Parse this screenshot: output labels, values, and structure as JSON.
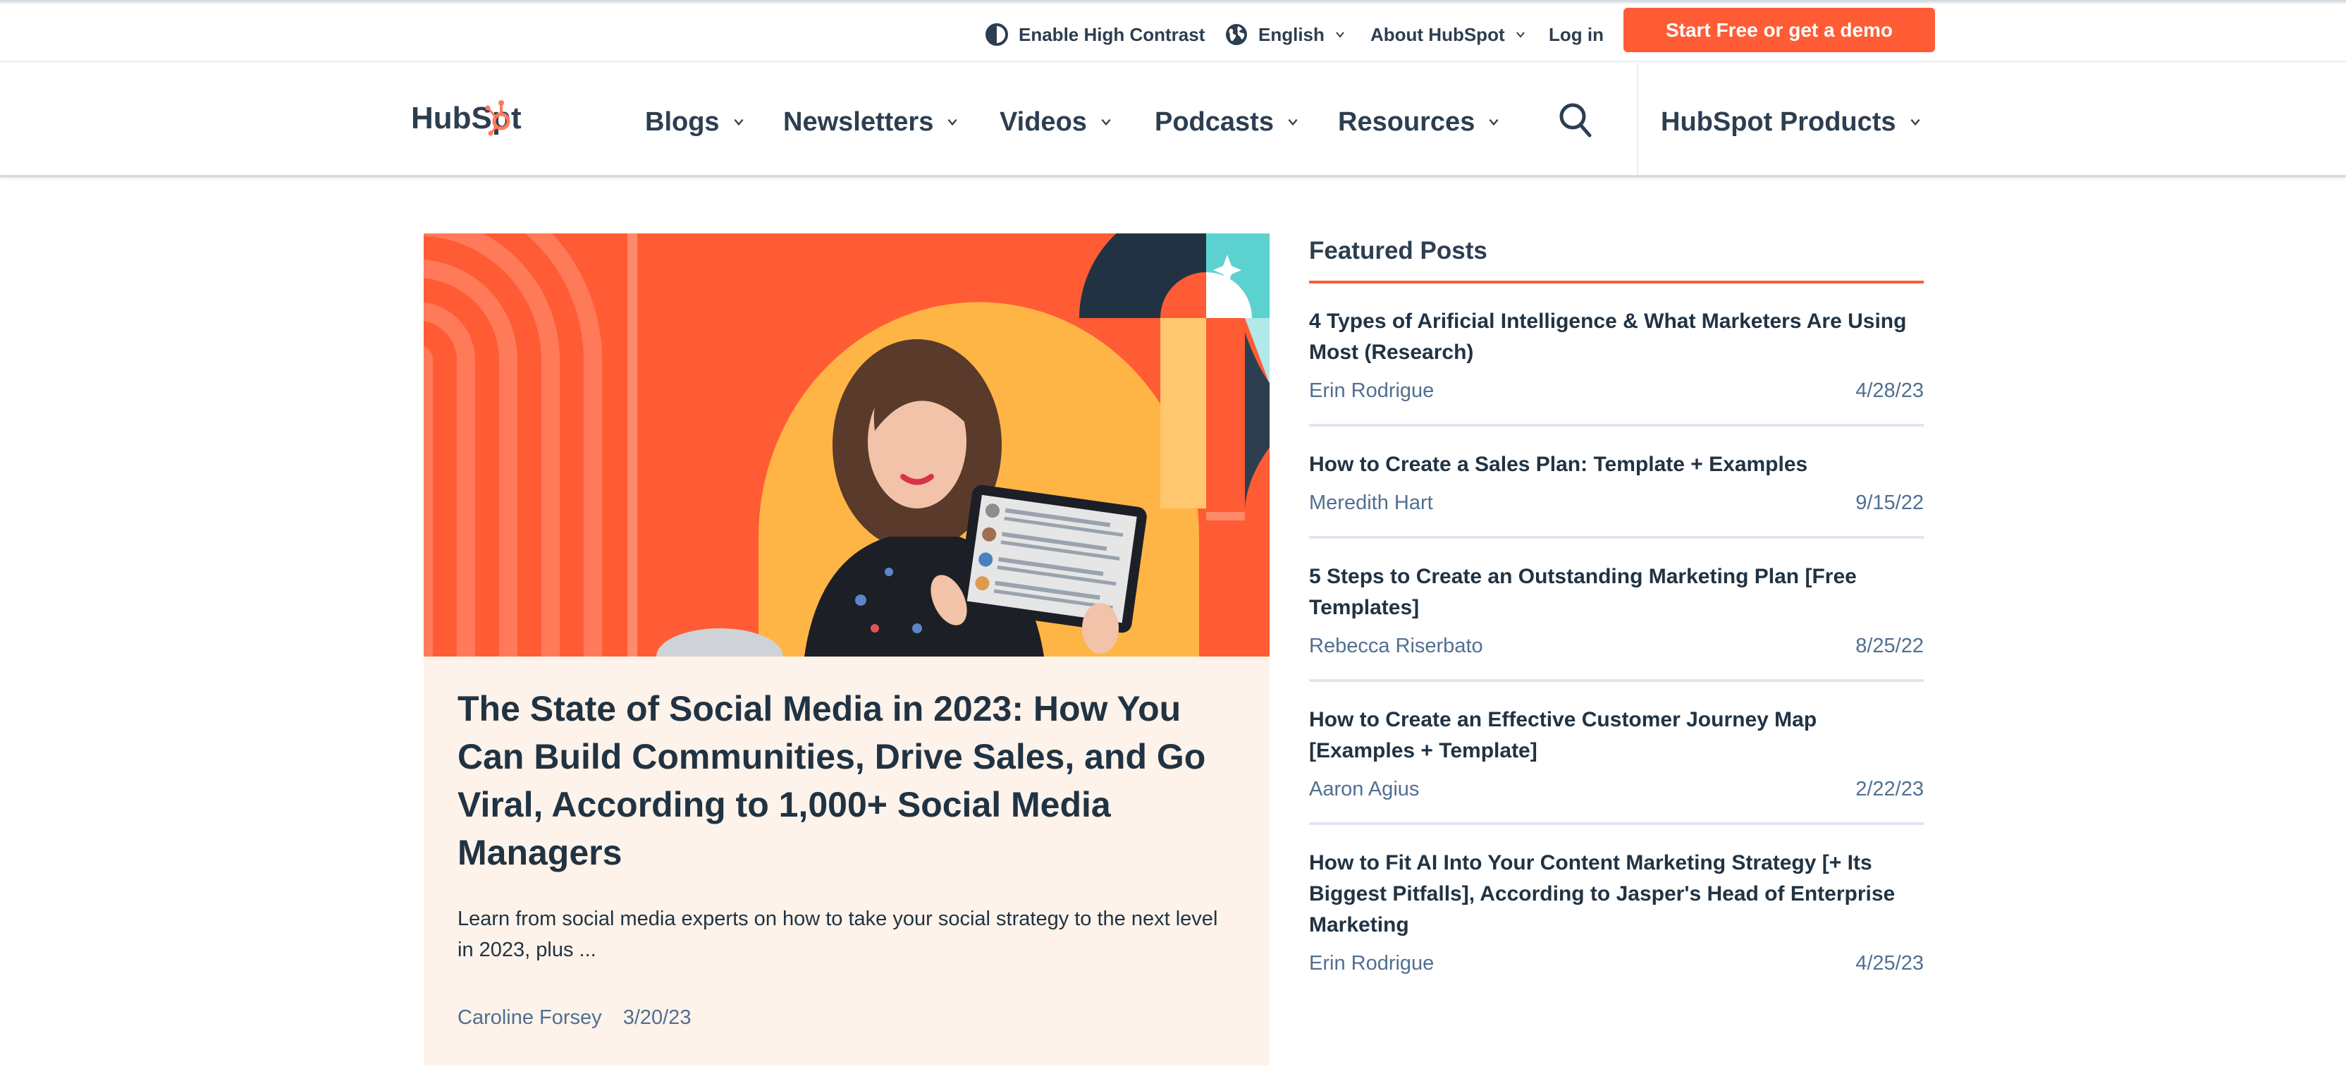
{
  "utility": {
    "high_contrast": {
      "label": "Enable High Contrast",
      "icon": "contrast-icon"
    },
    "language": {
      "label": "English",
      "icon": "globe-icon"
    },
    "about": {
      "label": "About HubSpot"
    },
    "login": {
      "label": "Log in"
    },
    "cta": {
      "label": "Start Free or get a demo"
    }
  },
  "nav": {
    "logo": {
      "text_part1": "HubSp",
      "text_part2": "t"
    },
    "items": [
      {
        "label": "Blogs"
      },
      {
        "label": "Newsletters"
      },
      {
        "label": "Videos"
      },
      {
        "label": "Podcasts"
      },
      {
        "label": "Resources"
      }
    ],
    "search_icon": "search-icon",
    "products": {
      "label": "HubSpot Products"
    }
  },
  "hero": {
    "title": "The State of Social Media in 2023: How You Can Build Communities, Drive Sales, and Go Viral, According to 1,000+ Social Media Managers",
    "description": "Learn from social media experts on how to take your social strategy to the next level in 2023, plus ...",
    "author": "Caroline Forsey",
    "date": "3/20/23"
  },
  "featured": {
    "heading": "Featured Posts",
    "posts": [
      {
        "title": "4 Types of Arificial Intelligence & What Marketers Are Using Most (Research)",
        "author": "Erin Rodrigue",
        "date": "4/28/23"
      },
      {
        "title": "How to Create a Sales Plan: Template + Examples",
        "author": "Meredith Hart",
        "date": "9/15/22"
      },
      {
        "title": "5 Steps to Create an Outstanding Marketing Plan [Free Templates]",
        "author": "Rebecca Riserbato",
        "date": "8/25/22"
      },
      {
        "title": "How to Create an Effective Customer Journey Map [Examples + Template]",
        "author": "Aaron Agius",
        "date": "2/22/23"
      },
      {
        "title": "How to Fit AI Into Your Content Marketing Strategy [+ Its Biggest Pitfalls], According to Jasper's Head of Enterprise Marketing",
        "author": "Erin Rodrigue",
        "date": "4/25/23"
      }
    ]
  },
  "colors": {
    "brand_orange": "#ff5c35",
    "text_dark": "#213343",
    "text_muted": "#516f90",
    "card_bg": "#fdf3ea"
  }
}
